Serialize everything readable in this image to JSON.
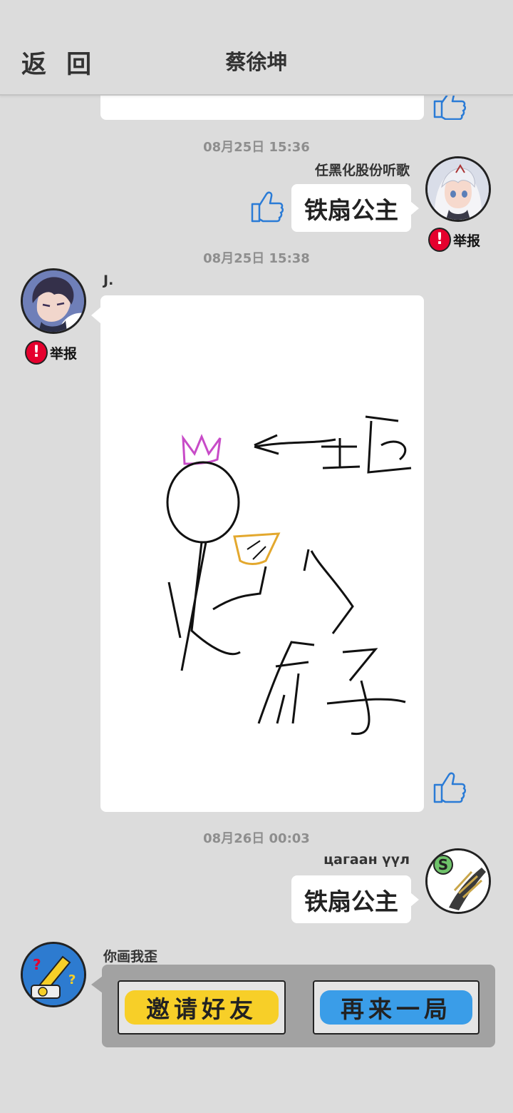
{
  "header": {
    "back_label": "返 回",
    "title": "蔡徐坤"
  },
  "messages": [
    {
      "timestamp": "08月25日  15:36",
      "nickname": "任黑化股份听歌",
      "text": "铁扇公主",
      "report": "举报"
    },
    {
      "timestamp": "08月25日  15:38",
      "nickname": "J.",
      "report": "举报"
    },
    {
      "timestamp": "08月26日  00:03",
      "nickname": "цагаан үүл",
      "text": "铁扇公主"
    },
    {
      "nickname": "你画我歪"
    }
  ],
  "game": {
    "invite_label": "邀请好友",
    "again_label": "再来一局"
  },
  "drawing": {
    "label_queen": "王后",
    "label_iron": "铁",
    "label_fan": "扇子"
  },
  "colors": {
    "background": "#dcdcdc",
    "report_red": "#e5002d",
    "like_blue": "#2a7bd6",
    "invite_yellow": "#f7cf28",
    "again_blue": "#3a9de8",
    "crown_magenta": "#c84bc8",
    "fan_gold": "#e3a82e"
  },
  "icons": [
    "thumbs-up-icon",
    "report-icon",
    "avatar"
  ]
}
